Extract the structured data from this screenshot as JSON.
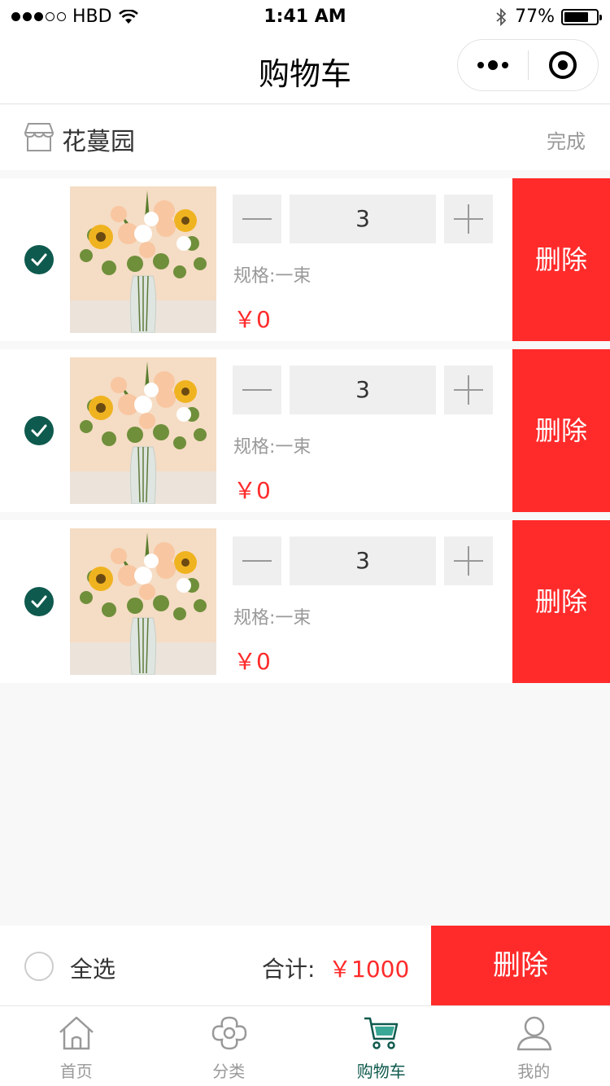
{
  "status_bar": {
    "carrier": "HBD",
    "time": "1:41 AM",
    "battery": "77%",
    "battery_level": 0.77
  },
  "nav": {
    "title": "购物车"
  },
  "shop": {
    "name": "花蔓园",
    "done_label": "完成"
  },
  "cart_items": [
    {
      "quantity": "3",
      "spec": "规格:一束",
      "price": "￥0",
      "delete_label": "删除",
      "checked": true,
      "image_icon": "flower-bouquet-image"
    },
    {
      "quantity": "3",
      "spec": "规格:一束",
      "price": "￥0",
      "delete_label": "删除",
      "checked": true,
      "image_icon": "flower-bouquet-image"
    },
    {
      "quantity": "3",
      "spec": "规格:一束",
      "price": "￥0",
      "delete_label": "删除",
      "checked": true,
      "image_icon": "flower-bouquet-image"
    }
  ],
  "action_bar": {
    "select_all_label": "全选",
    "total_label": "合计:",
    "total_value": "￥1000",
    "delete_label": "删除"
  },
  "tabs": [
    {
      "label": "首页",
      "icon": "home-icon",
      "active": false
    },
    {
      "label": "分类",
      "icon": "category-icon",
      "active": false
    },
    {
      "label": "购物车",
      "icon": "cart-icon",
      "active": true
    },
    {
      "label": "我的",
      "icon": "profile-icon",
      "active": false
    }
  ],
  "colors": {
    "accent": "#0f5a4e",
    "danger": "#ff2b2b",
    "muted": "#999999"
  }
}
